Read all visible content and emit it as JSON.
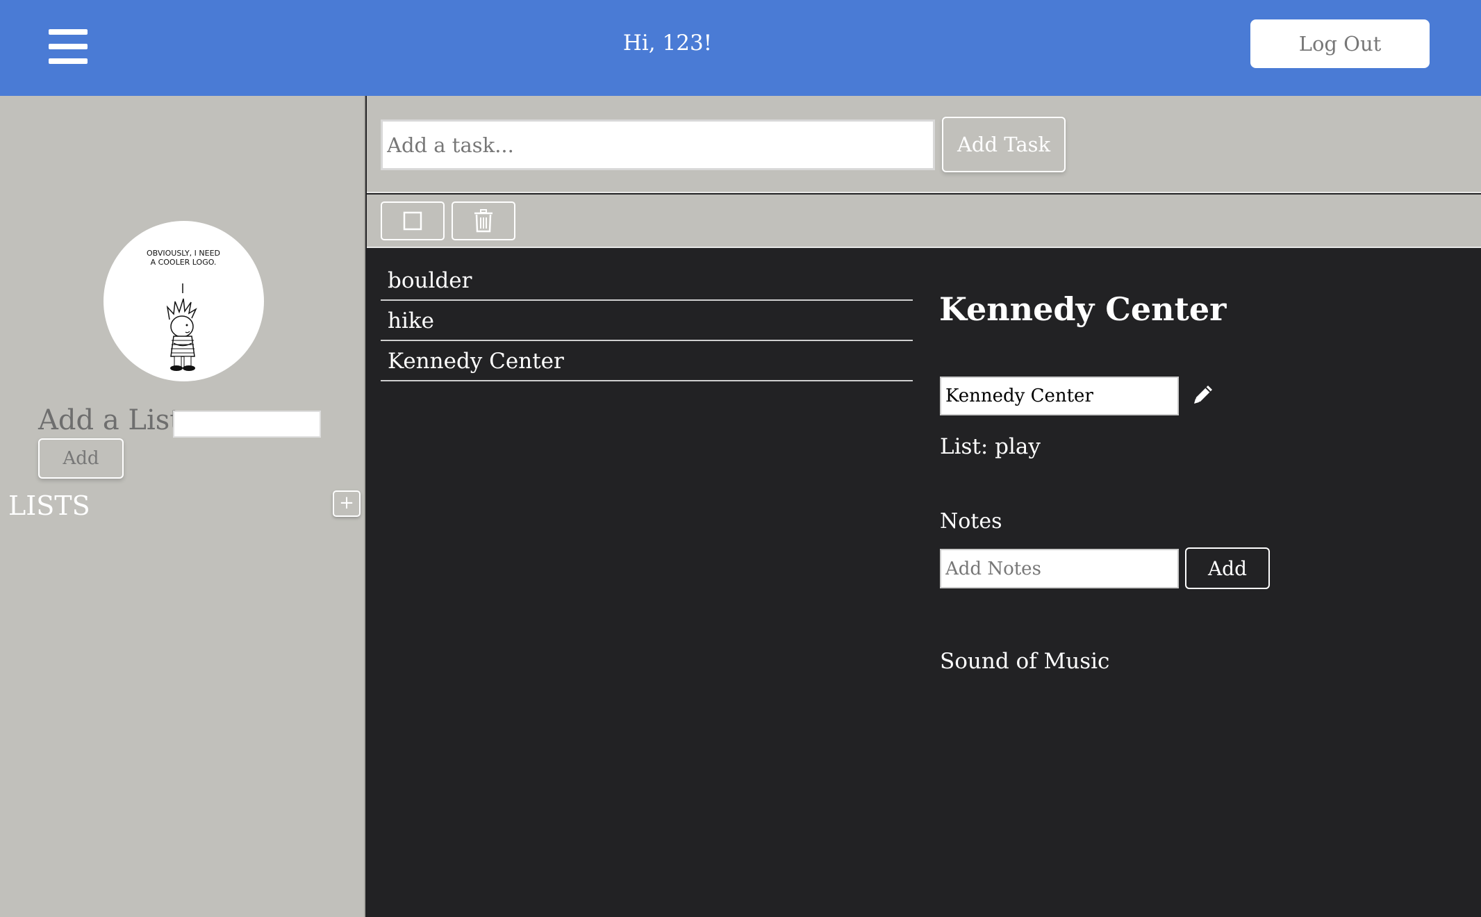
{
  "header": {
    "greeting": "Hi, 123!",
    "logout_label": "Log Out",
    "bg_color": "#4a7bd5"
  },
  "sidebar": {
    "avatar_caption": "OBVIOUSLY, I NEED A COOLER LOGO.",
    "add_list_label": "Add a List",
    "add_list_value": "",
    "add_button_label": "Add",
    "lists_heading": "LISTS",
    "lists_plus": "+"
  },
  "taskbar": {
    "task_placeholder": "Add a task...",
    "add_task_label": "Add Task"
  },
  "iconbar": {
    "icons": [
      "checkbox-icon",
      "trash-icon"
    ]
  },
  "tasks": [
    {
      "label": "boulder"
    },
    {
      "label": "hike"
    },
    {
      "label": "Kennedy Center"
    }
  ],
  "detail": {
    "title": "Kennedy Center",
    "name_value": "Kennedy Center",
    "list_line": "List: play",
    "notes_heading": "Notes",
    "notes_placeholder": "Add Notes",
    "notes_add_label": "Add",
    "notes": [
      "Sound of Music"
    ]
  }
}
